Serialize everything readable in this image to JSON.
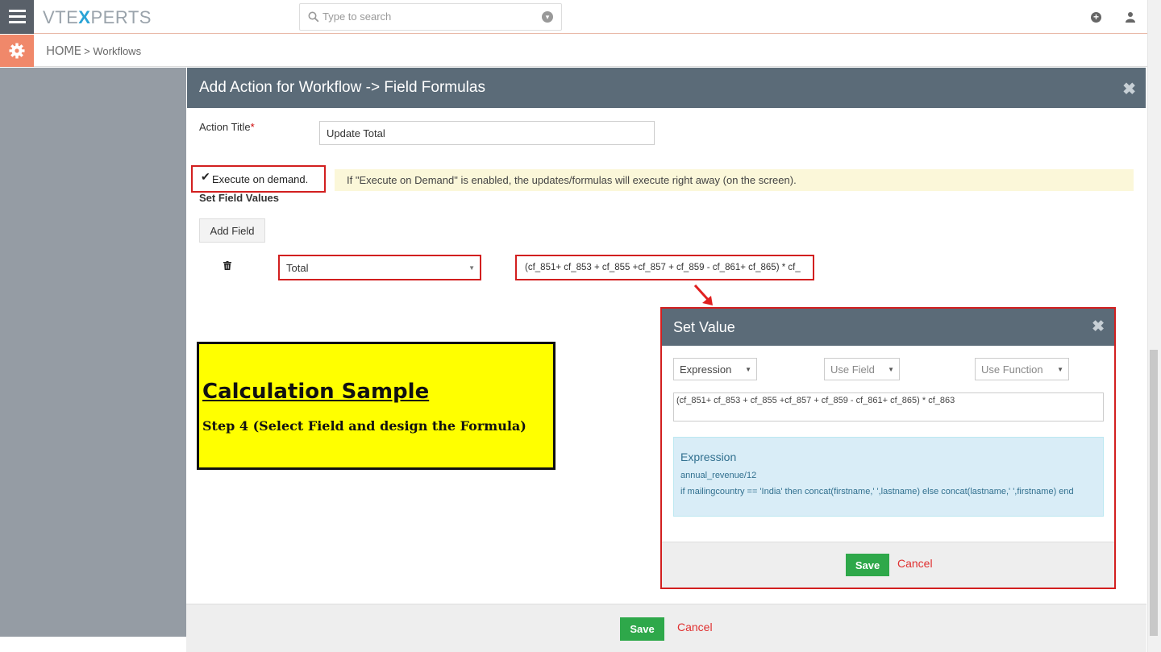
{
  "app": {
    "logo_left": "VTE",
    "logo_x": "X",
    "logo_right": "PERTS"
  },
  "search": {
    "placeholder": "Type to search"
  },
  "breadcrumb": {
    "home": "HOME",
    "separator": ">",
    "current": "Workflows"
  },
  "modal": {
    "title": "Add Action for Workflow -> Field Formulas",
    "close_glyph": "✖",
    "action_title_label": "Action Title",
    "required_mark": "*",
    "action_title_value": "Update Total",
    "execute_label": "Execute on demand.",
    "execute_checked": true,
    "execute_note": "If \"Execute on Demand\" is enabled, the updates/formulas will execute right away (on the screen).",
    "set_field_values": "Set Field Values",
    "add_field": "Add Field",
    "field_selected": "Total",
    "formula_preview": "(cf_851+ cf_853 + cf_855 +cf_857 + cf_859 - cf_861+ cf_865) * cf_",
    "save": "Save",
    "cancel": "Cancel"
  },
  "annotation": {
    "heading": "Calculation Sample",
    "subheading": "Step 4 (Select Field and design the Formula)"
  },
  "set_value": {
    "title": "Set Value",
    "close_glyph": "✖",
    "type_select": "Expression",
    "use_field": "Use Field",
    "use_function": "Use Function",
    "expression": "(cf_851+ cf_853 + cf_855 +cf_857 + cf_859 - cf_861+ cf_865) * cf_863",
    "help_heading": "Expression",
    "help_example_1": "annual_revenue/12",
    "help_example_2": "if mailingcountry == 'India' then concat(firstname,' ',lastname) else concat(lastname,' ',firstname) end",
    "save": "Save",
    "cancel": "Cancel"
  },
  "colors": {
    "header": "#5b6b78",
    "highlight": "#d21f1f",
    "save_green": "#2ea84a",
    "annotation_yellow": "#ffff00",
    "accent": "#f0886a"
  },
  "icons": [
    "menu-icon",
    "search-icon",
    "dropdown-icon",
    "plus-icon",
    "user-icon",
    "gear-icon",
    "trash-icon",
    "close-icon",
    "arrow-icon"
  ]
}
